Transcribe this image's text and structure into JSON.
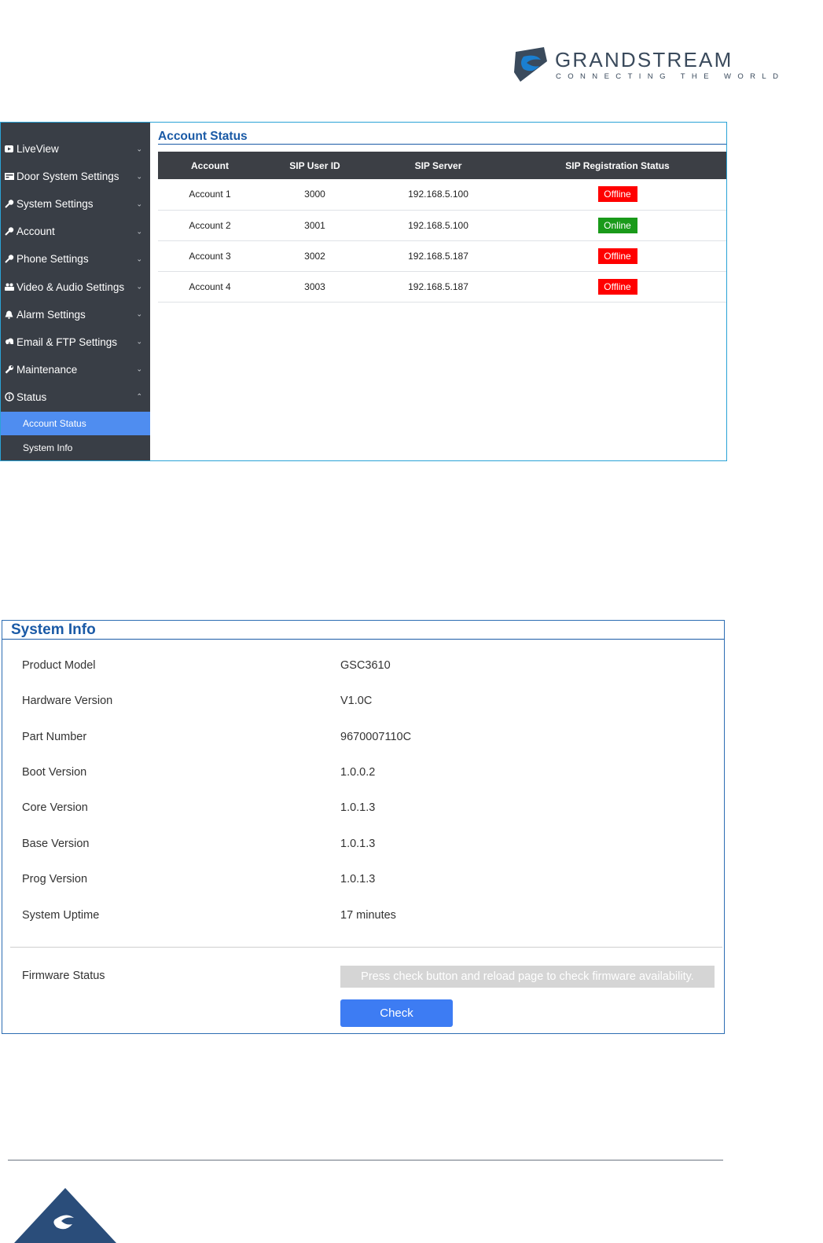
{
  "brand": {
    "name": "GRANDSTREAM",
    "tagline": "CONNECTING THE WORLD"
  },
  "sidebar": {
    "items": [
      {
        "label": "LiveView",
        "icon": "video-icon"
      },
      {
        "label": "Door System Settings",
        "icon": "door-icon"
      },
      {
        "label": "System Settings",
        "icon": "key-icon"
      },
      {
        "label": "Account",
        "icon": "key-icon"
      },
      {
        "label": "Phone Settings",
        "icon": "key-icon"
      },
      {
        "label": "Video & Audio Settings",
        "icon": "users-icon"
      },
      {
        "label": "Alarm Settings",
        "icon": "bell-icon"
      },
      {
        "label": "Email & FTP Settings",
        "icon": "cloud-icon"
      },
      {
        "label": "Maintenance",
        "icon": "wrench-icon"
      },
      {
        "label": "Status",
        "icon": "info-icon",
        "expanded": true
      }
    ],
    "sub_items": [
      {
        "label": "Account Status",
        "active": true
      },
      {
        "label": "System Info",
        "active": false
      }
    ]
  },
  "account_status": {
    "title": "Account Status",
    "columns": [
      "Account",
      "SIP User ID",
      "SIP Server",
      "SIP Registration Status"
    ],
    "rows": [
      {
        "account": "Account 1",
        "sip_user_id": "3000",
        "sip_server": "192.168.5.100",
        "status": "Offline",
        "status_color": "#ff0000"
      },
      {
        "account": "Account 2",
        "sip_user_id": "3001",
        "sip_server": "192.168.5.100",
        "status": "Online",
        "status_color": "#1a9a1a"
      },
      {
        "account": "Account 3",
        "sip_user_id": "3002",
        "sip_server": "192.168.5.187",
        "status": "Offline",
        "status_color": "#ff0000"
      },
      {
        "account": "Account 4",
        "sip_user_id": "3003",
        "sip_server": "192.168.5.187",
        "status": "Offline",
        "status_color": "#ff0000"
      }
    ]
  },
  "system_info": {
    "title": "System Info",
    "fields": [
      {
        "label": "Product Model",
        "value": "GSC3610"
      },
      {
        "label": "Hardware Version",
        "value": "V1.0C"
      },
      {
        "label": "Part Number",
        "value": "9670007110C"
      },
      {
        "label": "Boot Version",
        "value": "1.0.0.2"
      },
      {
        "label": "Core Version",
        "value": "1.0.1.3"
      },
      {
        "label": "Base Version",
        "value": "1.0.1.3"
      },
      {
        "label": "Prog Version",
        "value": "1.0.1.3"
      },
      {
        "label": "System Uptime",
        "value": "17 minutes"
      }
    ],
    "firmware_label": "Firmware Status",
    "firmware_message": "Press check button and reload page to check firmware availability.",
    "check_label": "Check"
  },
  "colors": {
    "accent": "#1a5aa6",
    "sidebar_bg": "#393e46",
    "active_item": "#4f8df0",
    "button": "#3d7cf3"
  }
}
